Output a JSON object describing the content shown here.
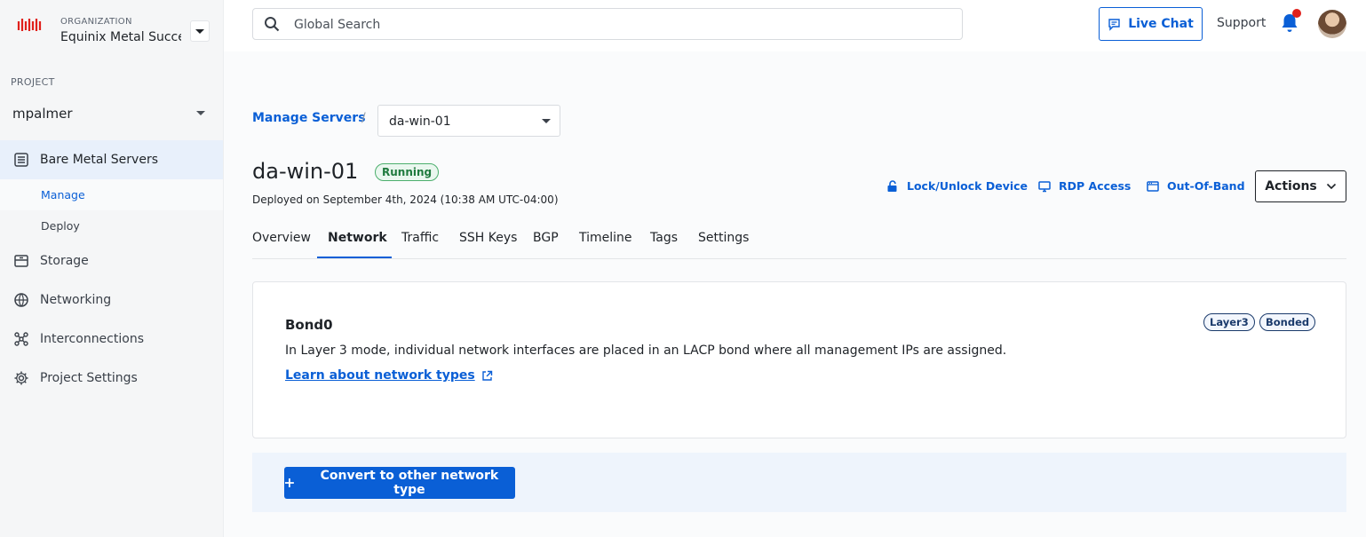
{
  "org": {
    "caption": "ORGANIZATION",
    "name": "Equinix Metal Success"
  },
  "project": {
    "caption": "PROJECT",
    "name": "mpalmer"
  },
  "sidebar": {
    "items": [
      {
        "label": "Bare Metal Servers",
        "icon": "server-icon",
        "active": true
      },
      {
        "label": "Storage",
        "icon": "storage-icon"
      },
      {
        "label": "Networking",
        "icon": "globe-icon"
      },
      {
        "label": "Interconnections",
        "icon": "interconnect-icon"
      },
      {
        "label": "Project Settings",
        "icon": "gear-icon"
      }
    ],
    "subitems": [
      {
        "label": "Manage",
        "active": true
      },
      {
        "label": "Deploy"
      }
    ]
  },
  "topbar": {
    "search_placeholder": "Global Search",
    "live_chat": "Live Chat",
    "support": "Support"
  },
  "breadcrumb": {
    "link": "Manage Servers",
    "separator": "/",
    "current": "da-win-01"
  },
  "server": {
    "name": "da-win-01",
    "status": "Running",
    "deployed": "Deployed on September 4th, 2024 (10:38 AM UTC-04:00)"
  },
  "header_actions": {
    "lock": "Lock/Unlock Device",
    "rdp": "RDP Access",
    "oob": "Out-Of-Band",
    "actions": "Actions"
  },
  "tabs": [
    "Overview",
    "Network",
    "Traffic",
    "SSH Keys",
    "BGP",
    "Timeline",
    "Tags",
    "Settings"
  ],
  "active_tab": "Network",
  "bond": {
    "title": "Bond0",
    "description": "In Layer 3 mode, individual network interfaces are placed in an LACP bond where all management IPs are assigned.",
    "link": "Learn about network types",
    "tags": [
      "Layer3",
      "Bonded"
    ]
  },
  "convert_button": "Convert to other network type",
  "colors": {
    "accent": "#0a5fd6",
    "brand": "#e0201b",
    "running": "#1f7a3e"
  }
}
